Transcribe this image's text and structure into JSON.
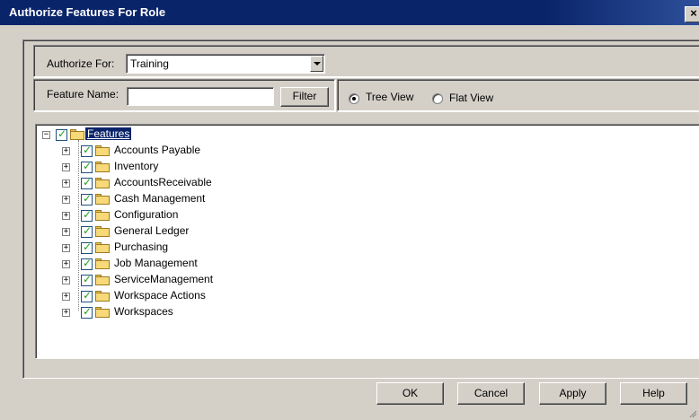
{
  "window": {
    "title": "Authorize Features For Role",
    "close_label": "×"
  },
  "authorize": {
    "label": "Authorize For:",
    "value": "Training"
  },
  "filter": {
    "label": "Feature Name:",
    "value": "",
    "placeholder": "",
    "button_label": "Filter"
  },
  "view": {
    "tree_label": "Tree View",
    "flat_label": "Flat View",
    "selected": "tree"
  },
  "tree": {
    "root": {
      "label": "Features",
      "expander": "−",
      "checked": true
    },
    "children": [
      {
        "label": "Accounts Payable",
        "expander": "+",
        "checked": true
      },
      {
        "label": "Inventory",
        "expander": "+",
        "checked": true
      },
      {
        "label": "AccountsReceivable",
        "expander": "+",
        "checked": true
      },
      {
        "label": "Cash Management",
        "expander": "+",
        "checked": true
      },
      {
        "label": "Configuration",
        "expander": "+",
        "checked": true
      },
      {
        "label": "General Ledger",
        "expander": "+",
        "checked": true
      },
      {
        "label": "Purchasing",
        "expander": "+",
        "checked": true
      },
      {
        "label": "Job Management",
        "expander": "+",
        "checked": true
      },
      {
        "label": "ServiceManagement",
        "expander": "+",
        "checked": true
      },
      {
        "label": "Workspace Actions",
        "expander": "+",
        "checked": true
      },
      {
        "label": "Workspaces",
        "expander": "+",
        "checked": true
      }
    ]
  },
  "buttons": {
    "ok": "OK",
    "cancel": "Cancel",
    "apply": "Apply",
    "help": "Help"
  },
  "colors": {
    "titlebar": "#0a246a",
    "face": "#d4d0c8",
    "check": "#21a121",
    "folder": "#f7d979"
  }
}
